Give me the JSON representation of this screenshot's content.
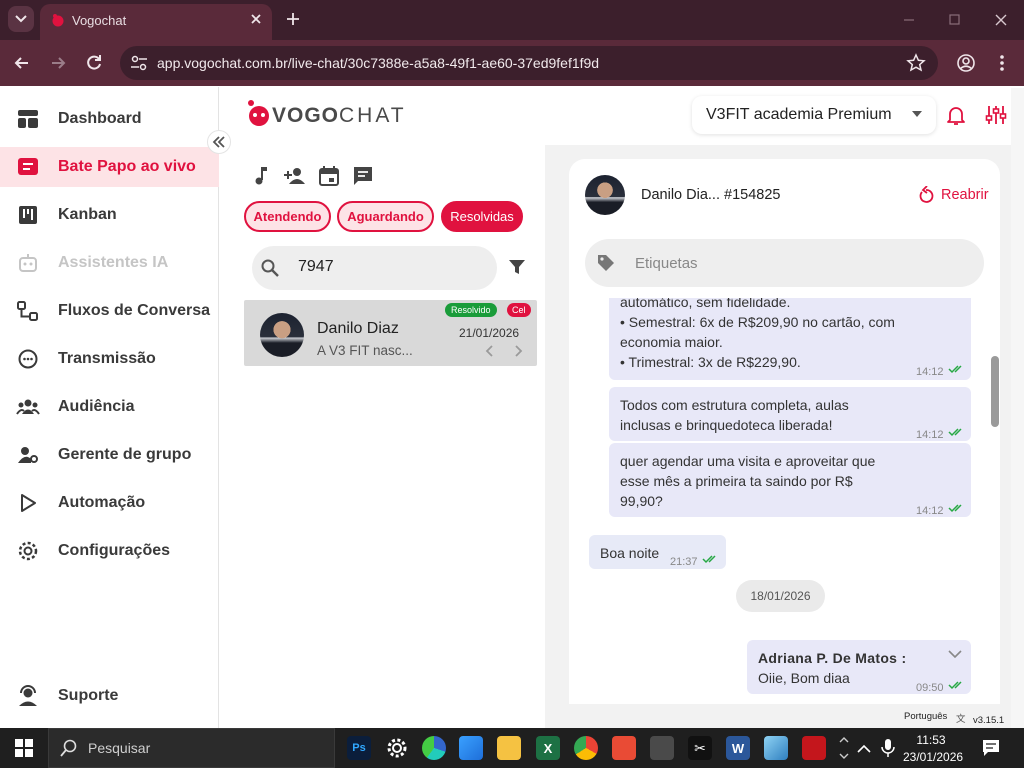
{
  "browser": {
    "tab_title": "Vogochat",
    "url": "app.vogochat.com.br/live-chat/30c7388e-a5a8-49f1-ae60-37ed9fef1f9d"
  },
  "sidebar": {
    "items": [
      {
        "label": "Dashboard",
        "icon": "dashboard-icon"
      },
      {
        "label": "Bate Papo ao vivo",
        "icon": "chat-icon"
      },
      {
        "label": "Kanban",
        "icon": "kanban-icon"
      },
      {
        "label": "Assistentes IA",
        "icon": "robot-icon"
      },
      {
        "label": "Fluxos de Conversa",
        "icon": "flow-icon"
      },
      {
        "label": "Transmissão",
        "icon": "broadcast-icon"
      },
      {
        "label": "Audiência",
        "icon": "audience-icon"
      },
      {
        "label": "Gerente de grupo",
        "icon": "group-manager-icon"
      },
      {
        "label": "Automação",
        "icon": "play-icon"
      },
      {
        "label": "Configurações",
        "icon": "gear-icon"
      }
    ],
    "support_label": "Suporte"
  },
  "header": {
    "logo_vogo": "VOGO",
    "logo_chat": "CHAT",
    "account": "V3FIT academia Premium"
  },
  "list": {
    "status_tabs": [
      "Atendendo",
      "Aguardando",
      "Resolvidas"
    ],
    "search_value": "7947",
    "conversation": {
      "name": "Danilo Diaz",
      "date": "21/01/2026",
      "preview": "A V3 FIT nasc...",
      "badge_status": "Resolvido",
      "badge_channel": "Cel"
    }
  },
  "chat": {
    "contact": "Danilo Dia... #154825",
    "reopen_label": "Reabrir",
    "tags_placeholder": "Etiquetas",
    "messages": [
      {
        "line1": "automático, sem fidelidade.",
        "line2": "• Semestral: 6x de R$209,90 no cartão, com",
        "line3": "economia maior.",
        "line4": "• Trimestral: 3x de R$229,90.",
        "time": "14:12"
      },
      {
        "line1": "Todos com estrutura completa, aulas",
        "line2": "inclusas e brinquedoteca liberada!",
        "time": "14:12"
      },
      {
        "line1": "quer agendar uma visita e aproveitar que",
        "line2": "esse mês a primeira ta saindo por R$",
        "line3": "99,90?",
        "time": "14:12"
      },
      {
        "line1": "Boa noite",
        "time": "21:37"
      },
      {
        "author": "Adriana P. De Matos :",
        "line1": "Oiie, Bom diaa",
        "time": "09:50"
      }
    ],
    "date_divider": "18/01/2026"
  },
  "footer": {
    "language": "Português",
    "version": "v3.15.1"
  },
  "taskbar": {
    "search_placeholder": "Pesquisar",
    "time": "11:53",
    "date": "23/01/2026"
  },
  "colors": {
    "brand": "#e0123f",
    "brand_light": "#fde3e6",
    "chrome_dark": "#3c1f2c",
    "chrome_mid": "#5a2a3a",
    "resolved_badge": "#1a9c3a"
  }
}
